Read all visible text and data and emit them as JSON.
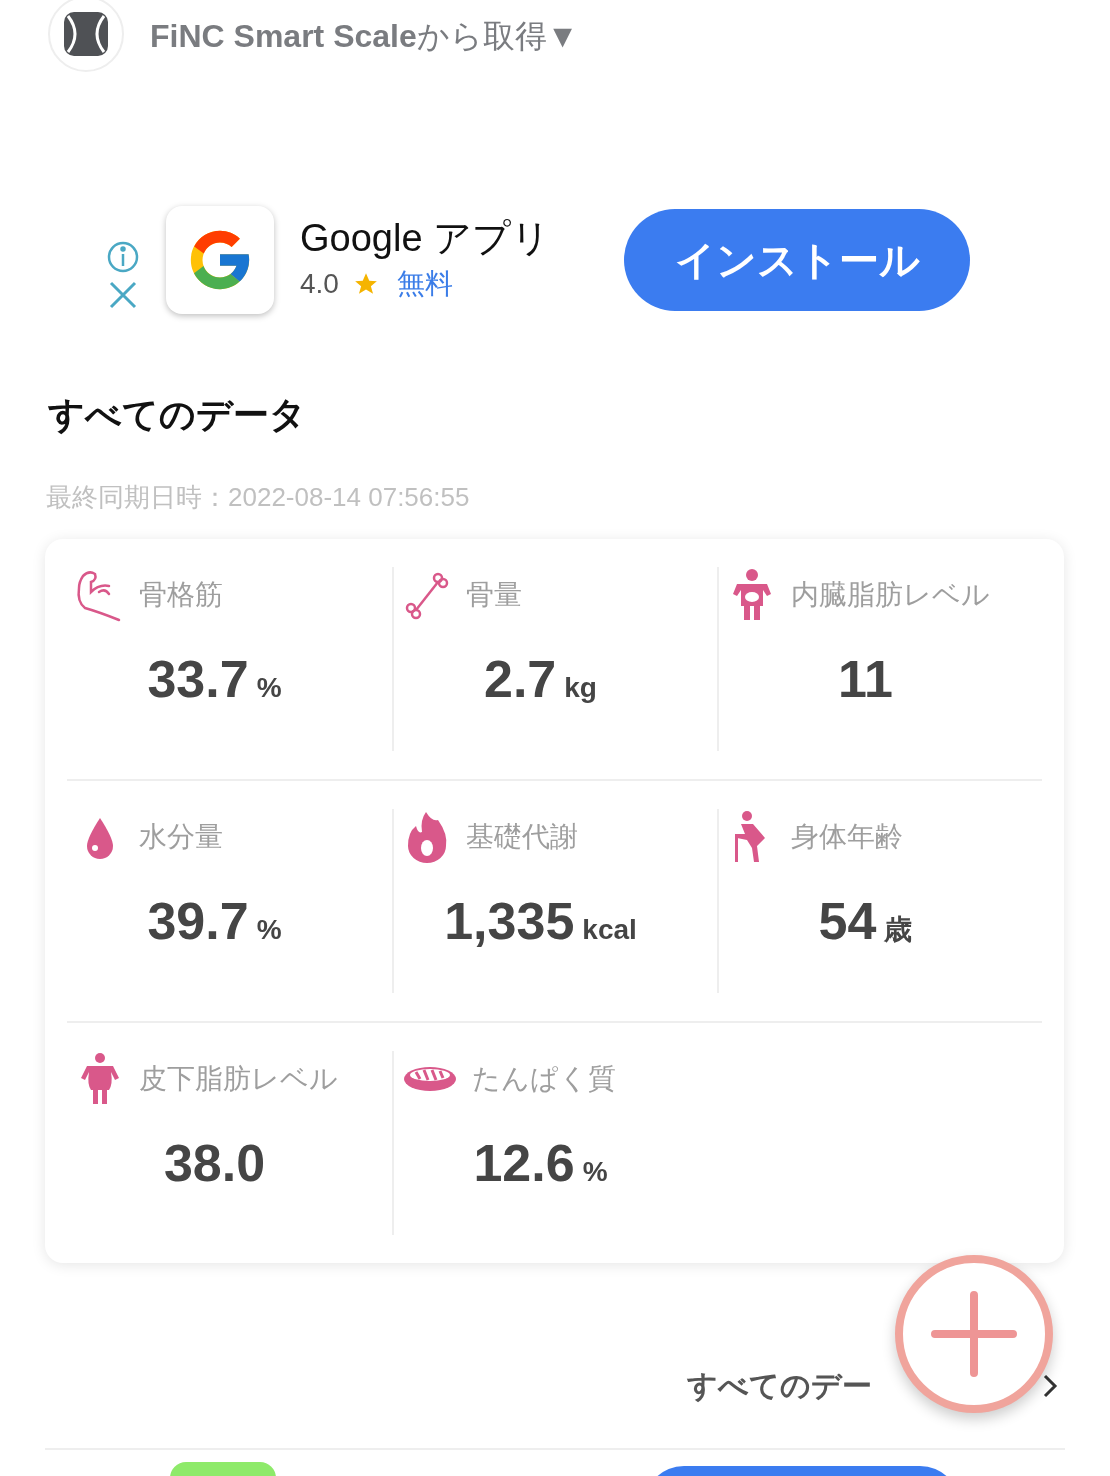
{
  "source": {
    "label": "FiNC Smart Scale",
    "suffix": "から取得▼"
  },
  "ad": {
    "title": "Google アプリ",
    "rating": "4.0",
    "price": "無料",
    "button": "インストール"
  },
  "section": {
    "title": "すべてのデータ",
    "sync_time": "最終同期日時：2022-08-14 07:56:55"
  },
  "metrics": [
    [
      {
        "kind": "muscle",
        "label": "骨格筋",
        "value": "33.7",
        "unit": "%"
      },
      {
        "kind": "bone",
        "label": "骨量",
        "value": "2.7",
        "unit": "kg"
      },
      {
        "kind": "visceral",
        "label": "内臓脂肪レベル",
        "value": "11"
      }
    ],
    [
      {
        "kind": "water",
        "label": "水分量",
        "value": "39.7",
        "unit": "%"
      },
      {
        "kind": "flame",
        "label": "基礎代謝",
        "value": "1,335",
        "unit": "kcal"
      },
      {
        "kind": "elder",
        "label": "身体年齢",
        "value": "54",
        "unit": "歳"
      }
    ],
    [
      {
        "kind": "body",
        "label": "皮下脂肪レベル",
        "value": "38.0"
      },
      {
        "kind": "meat",
        "label": "たんぱく質",
        "value": "12.6",
        "unit": "%"
      }
    ]
  ],
  "link": {
    "label": "すべてのデー"
  }
}
